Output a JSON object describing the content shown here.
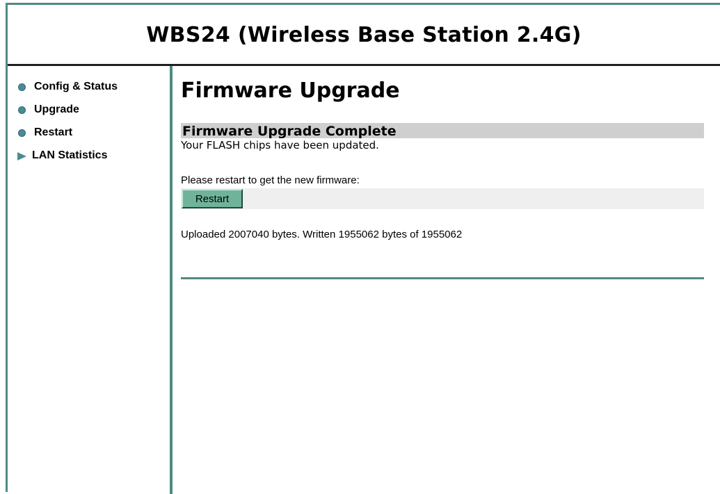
{
  "header": {
    "title": "WBS24 (Wireless Base Station 2.4G)"
  },
  "sidebar": {
    "items": [
      {
        "label": "Config & Status",
        "icon": "circle-bullet-icon"
      },
      {
        "label": "Upgrade",
        "icon": "circle-bullet-icon"
      },
      {
        "label": "Restart",
        "icon": "circle-bullet-icon"
      },
      {
        "label": "LAN Statistics",
        "icon": "triangle-arrow-icon"
      }
    ]
  },
  "main": {
    "page_title": "Firmware Upgrade",
    "section_heading": "Firmware Upgrade Complete",
    "status_message": "Your FLASH chips have been updated.",
    "restart_prompt": "Please restart to get the new firmware:",
    "restart_button_label": "Restart",
    "upload_info": "Uploaded 2007040 bytes. Written 1955062 bytes of 1955062"
  },
  "colors": {
    "accent": "#4f8a82",
    "bullet": "#4a8c96",
    "button": "#6fb49a",
    "section_heading_bg": "#cfcfcf"
  }
}
